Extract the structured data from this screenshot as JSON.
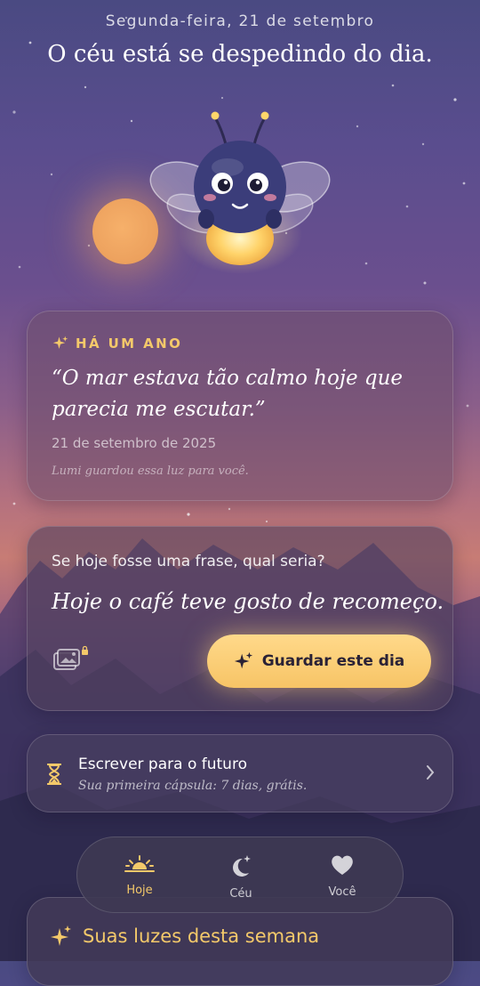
{
  "header": {
    "date": "Segunda-feira, 21 de setembro",
    "headline": "O céu está se despedindo do dia."
  },
  "scene": {
    "sun_icon": "sun-icon",
    "mascot_icon": "firefly-mascot-icon"
  },
  "memory_card": {
    "eyebrow": "HÁ UM ANO",
    "eyebrow_icon": "sparkle-icon",
    "quote": "“O mar estava tão calmo hoje que parecia me escutar.”",
    "date": "21 de setembro de 2025",
    "footnote": "Lumi guardou essa luz para você."
  },
  "prompt_card": {
    "question": "Se hoje fosse uma frase, qual seria?",
    "answer": "Hoje o café teve gosto de recomeço.",
    "photo_icon": "photo-locked-icon",
    "save_label": "Guardar este dia",
    "save_icon": "sparkle-icon"
  },
  "future_card": {
    "icon": "hourglass-icon",
    "title": "Escrever para o futuro",
    "subtitle": "Sua primeira cápsula: 7 dias, grátis."
  },
  "tabs": [
    {
      "label": "Hoje",
      "icon": "sunset-icon",
      "active": true
    },
    {
      "label": "Céu",
      "icon": "moon-stars-icon",
      "active": false
    },
    {
      "label": "Você",
      "icon": "heart-icon",
      "active": false
    }
  ],
  "weekly_card": {
    "title": "Suas luzes desta semana",
    "icon": "sparkle-icon"
  },
  "colors": {
    "accent_gold": "#f4c96a",
    "button_yellow": "#ffd98a",
    "sun_orange": "#f6b06a"
  }
}
